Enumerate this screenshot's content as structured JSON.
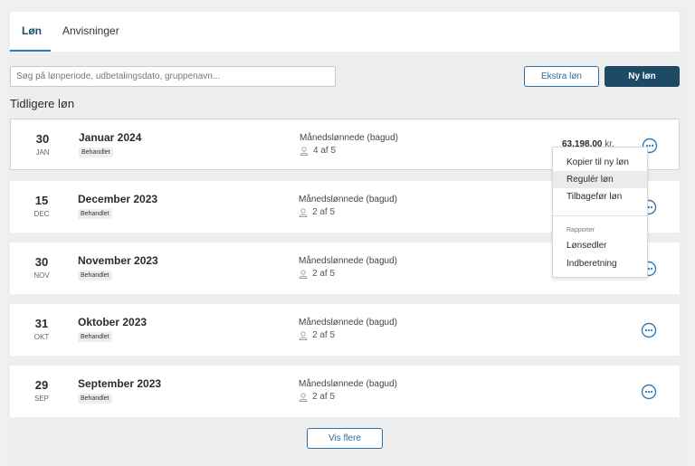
{
  "tabs": [
    {
      "label": "Løn"
    },
    {
      "label": "Anvisninger"
    }
  ],
  "search": {
    "placeholder": "Søg på lønperiode, udbetalingsdato, gruppenavn..."
  },
  "buttons": {
    "extra": "Ekstra løn",
    "new": "Ny løn",
    "more": "Vis flere"
  },
  "section_title": "Tidligere løn",
  "payrolls": [
    {
      "day": "30",
      "month": "JAN",
      "title": "Januar 2024",
      "status": "Behandlet",
      "group": "Månedslønnede (bagud)",
      "count": "4 af 5",
      "amount": "63.198,00",
      "unit": "kr."
    },
    {
      "day": "15",
      "month": "DEC",
      "title": "December 2023",
      "status": "Behandlet",
      "group": "Månedslønnede (bagud)",
      "count": "2 af 5"
    },
    {
      "day": "30",
      "month": "NOV",
      "title": "November 2023",
      "status": "Behandlet",
      "group": "Månedslønnede (bagud)",
      "count": "2 af 5"
    },
    {
      "day": "31",
      "month": "OKT",
      "title": "Oktober 2023",
      "status": "Behandlet",
      "group": "Månedslønnede (bagud)",
      "count": "2 af 5"
    },
    {
      "day": "29",
      "month": "SEP",
      "title": "September 2023",
      "status": "Behandlet",
      "group": "Månedslønnede (bagud)",
      "count": "2 af 5"
    }
  ],
  "menu": {
    "items": [
      "Kopier til ny løn",
      "Regulér løn",
      "Tilbagefør løn"
    ],
    "section": "Rapporter",
    "report_items": [
      "Lønsedler",
      "Indberetning"
    ]
  },
  "colors": {
    "primary": "#1f4a66",
    "accent": "#2e7bbd",
    "link": "#2e6fa3"
  },
  "icons": {
    "count": "person-icon",
    "actions": "more-options-icon"
  }
}
